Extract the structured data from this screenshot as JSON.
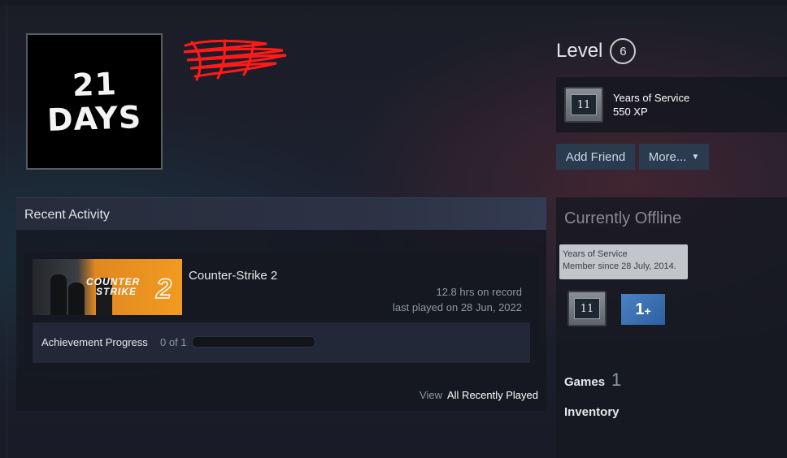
{
  "profile": {
    "avatar_text": [
      "21",
      "DAYS"
    ]
  },
  "level": {
    "label": "Level",
    "value": "6"
  },
  "featured_badge": {
    "icon": "years-of-service-badge",
    "badge_number": "11",
    "title": "Years of Service",
    "xp": "550 XP"
  },
  "actions": {
    "add_friend": "Add Friend",
    "more": "More..."
  },
  "recent_activity": {
    "title": "Recent Activity",
    "game": {
      "name": "Counter-Strike 2",
      "capsule_text": [
        "COUNTER",
        "STRIKE",
        "2"
      ],
      "hours": "12.8 hrs on record",
      "last_played": "last played on 28 Jun, 2022"
    },
    "achievement": {
      "label": "Achievement Progress",
      "count": "0 of 1",
      "progress": 0
    },
    "view_label": "View",
    "view_link": "All Recently Played"
  },
  "sidebar": {
    "status": "Currently Offline",
    "tooltip": {
      "line1": "Years of Service",
      "line2": "Member since 28 July, 2014."
    },
    "badges": [
      {
        "icon": "years-of-service-badge",
        "text": "11"
      },
      {
        "icon": "one-plus-badge",
        "text": "1",
        "suffix": "+"
      }
    ],
    "games_label": "Games",
    "games_count": "1",
    "inventory_label": "Inventory"
  },
  "colors": {
    "background": "#1b1f2b",
    "button": "#2a3b4f",
    "accent_orange": "#f29a20",
    "badge_blue": "#3b73b8",
    "redaction": "#ff1a1a"
  }
}
